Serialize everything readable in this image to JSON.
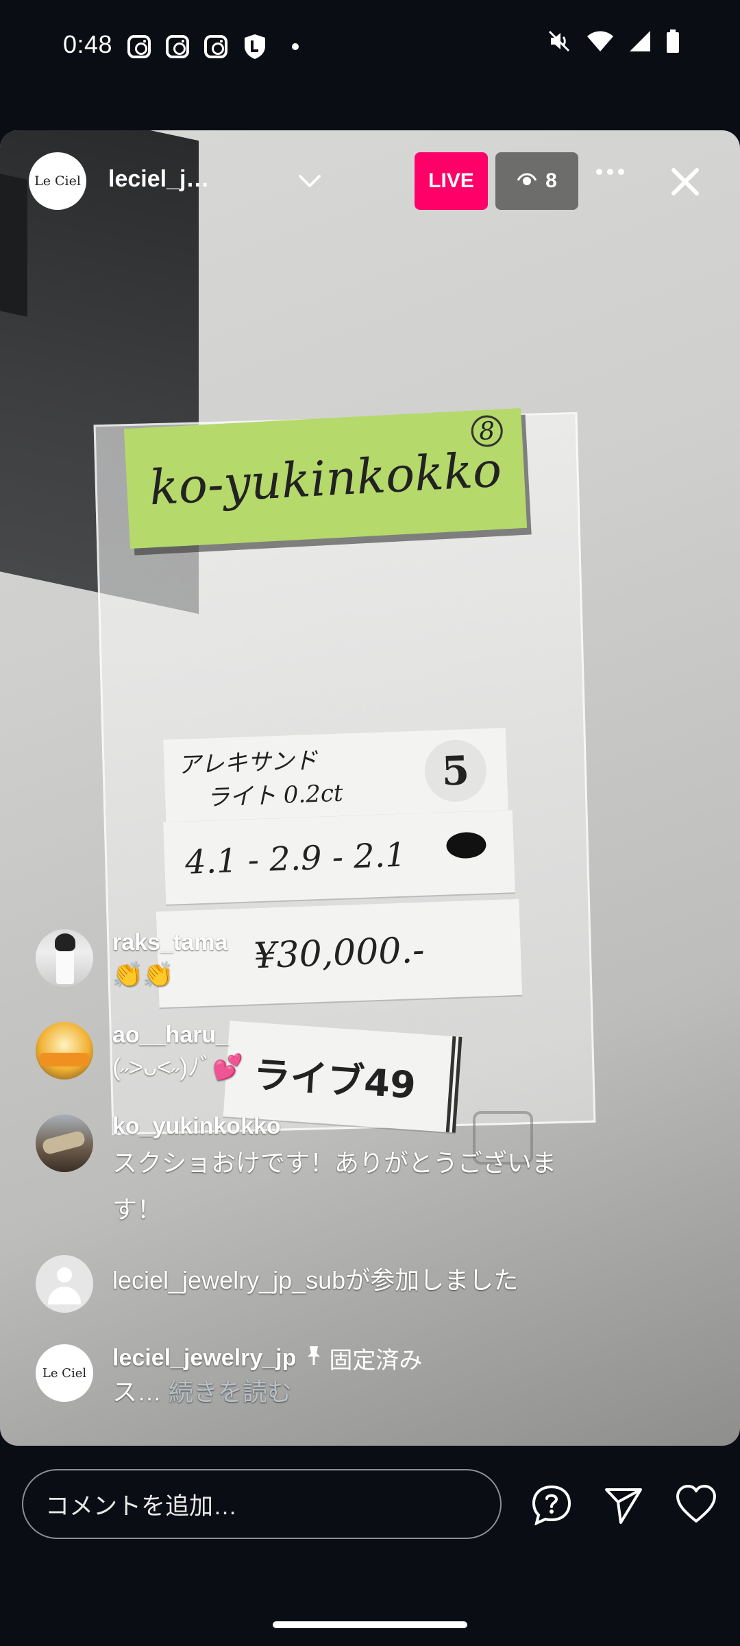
{
  "status_bar": {
    "time": "0:48",
    "left_icons": [
      "instagram-icon",
      "instagram-icon",
      "instagram-icon",
      "shield-icon",
      "notification-dot-icon"
    ],
    "right_icons": [
      "mute-icon",
      "wifi-icon",
      "signal-icon",
      "battery-icon"
    ]
  },
  "live": {
    "host_avatar_text": "Le Ciel",
    "host_name": "leciel_j…",
    "live_label": "LIVE",
    "viewer_count": "8",
    "colors": {
      "live_badge": "#ff0069",
      "viewer_badge": "#5a5a5a"
    }
  },
  "video_content": {
    "sticky_note": "ko-yukinkokko",
    "sticky_mark": "8",
    "card1_line1": "アレキサンド",
    "card1_line2": "ライト 0.2ct",
    "card1_number": "5",
    "card2": "4.1 - 2.9 - 2.1",
    "card3": "¥30,000.-",
    "card4": "ライブ49"
  },
  "comments": [
    {
      "user": "raks_tama",
      "text": "👏👏"
    },
    {
      "user": "ao__haru_",
      "text": "(˶>ᴗ<˶)ﾉﾞ💕"
    },
    {
      "user": "ko_yukinkokko",
      "text": "スクショおけです！ありがとうございま",
      "text2": "す！"
    },
    {
      "system": "leciel_jewelry_jp_subが参加しました"
    },
    {
      "user": "leciel_jewelry_jp",
      "pinned": "固定済み",
      "text": "ス…",
      "more": " 続きを読む",
      "avatar_text": "Le Ciel"
    }
  ],
  "bottom_bar": {
    "comment_placeholder": "コメントを追加…",
    "icons": [
      "question-icon",
      "send-icon",
      "heart-icon"
    ]
  }
}
